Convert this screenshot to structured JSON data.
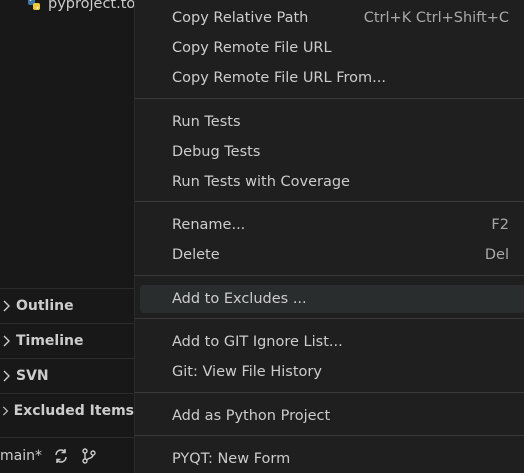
{
  "sidebar": {
    "file_name": "pyproject.toml",
    "sections": [
      {
        "label": "Outline"
      },
      {
        "label": "Timeline"
      },
      {
        "label": "SVN"
      },
      {
        "label": "Excluded Items"
      }
    ]
  },
  "statusbar": {
    "branch": "main*"
  },
  "context_menu": {
    "items": [
      {
        "label": "Copy Relative Path",
        "shortcut": "Ctrl+K Ctrl+Shift+C"
      },
      {
        "label": "Copy Remote File URL",
        "shortcut": ""
      },
      {
        "label": "Copy Remote File URL From...",
        "shortcut": ""
      },
      {
        "label": "Run Tests",
        "shortcut": ""
      },
      {
        "label": "Debug Tests",
        "shortcut": ""
      },
      {
        "label": "Run Tests with Coverage",
        "shortcut": ""
      },
      {
        "label": "Rename...",
        "shortcut": "F2"
      },
      {
        "label": "Delete",
        "shortcut": "Del"
      },
      {
        "label": "Add to Excludes ...",
        "shortcut": ""
      },
      {
        "label": "Add to GIT Ignore List...",
        "shortcut": ""
      },
      {
        "label": "Git: View File History",
        "shortcut": ""
      },
      {
        "label": "Add as Python Project",
        "shortcut": ""
      },
      {
        "label": "PYQT: New Form",
        "shortcut": ""
      }
    ]
  }
}
